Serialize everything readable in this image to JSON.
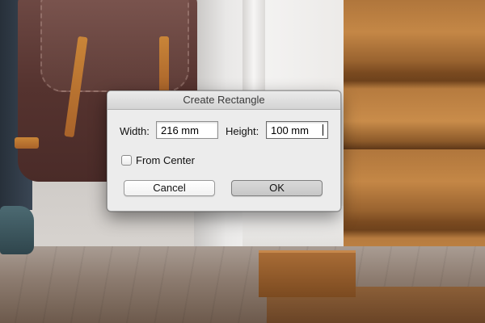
{
  "dialog": {
    "title": "Create Rectangle",
    "width_label": "Width:",
    "width_value": "216 mm",
    "height_label": "Height:",
    "height_value": "100 mm",
    "from_center_label": "From Center",
    "from_center_checked": false,
    "cancel_label": "Cancel",
    "ok_label": "OK"
  }
}
